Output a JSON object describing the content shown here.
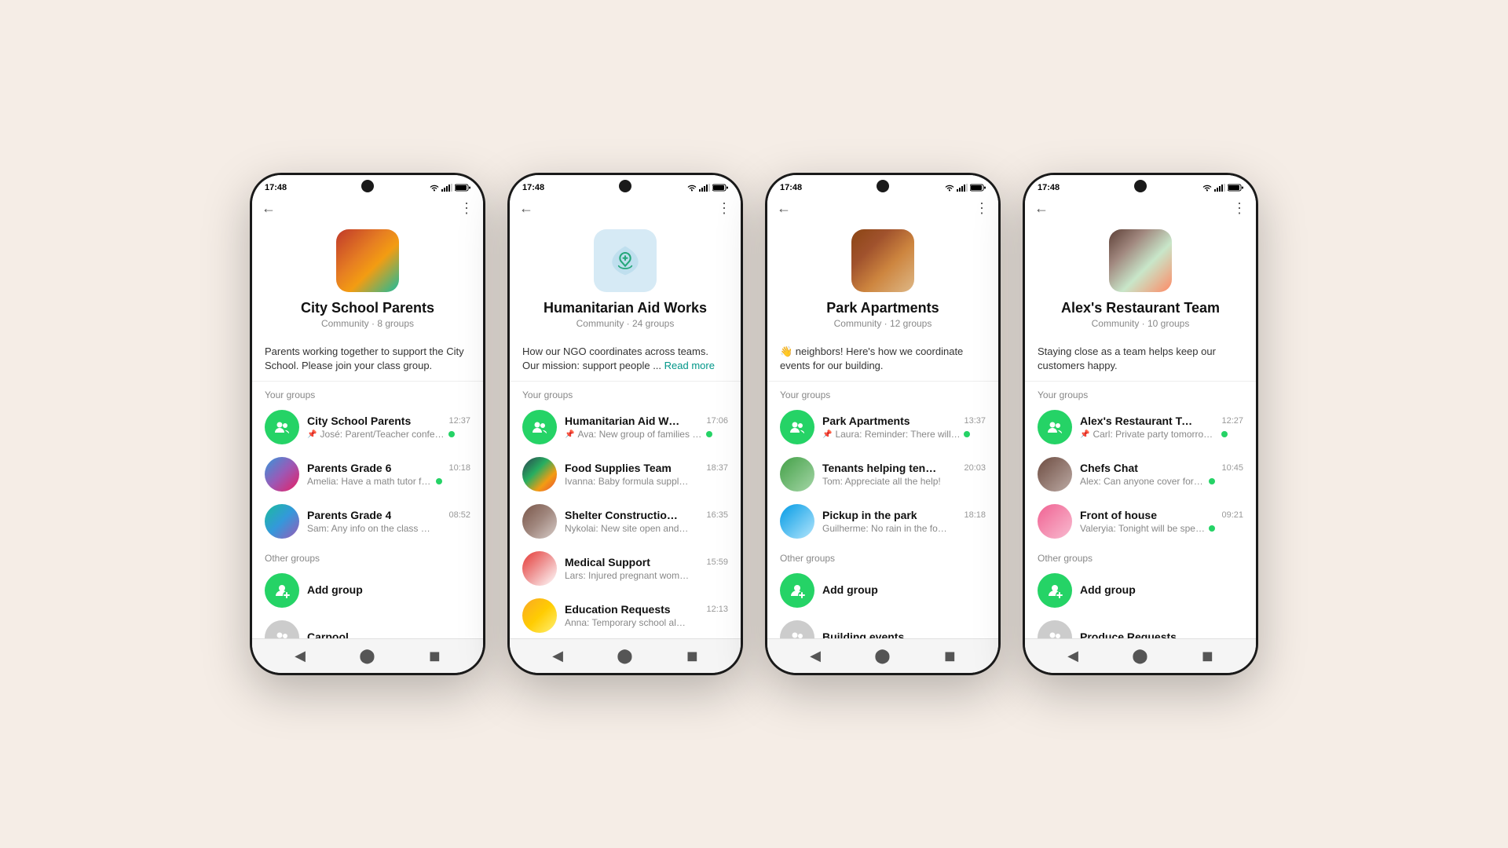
{
  "phones": [
    {
      "id": "city-school",
      "statusTime": "17:48",
      "communityName": "City School Parents",
      "communitySub": "Community · 8 groups",
      "avatarType": "photo",
      "avatarClass": "photo-books",
      "description": "Parents working together to support the City School. Please join your class group.",
      "readMore": false,
      "yourGroupsLabel": "Your groups",
      "yourGroups": [
        {
          "name": "City School Parents",
          "time": "12:37",
          "msg": "José: Parent/Teacher conferen...",
          "avatarType": "green-icon",
          "pinned": true,
          "online": true
        },
        {
          "name": "Parents Grade 6",
          "time": "10:18",
          "msg": "Amelia: Have a math tutor for the...",
          "avatarType": "photo",
          "avatarClass": "photo-grade6",
          "pinned": false,
          "online": true
        },
        {
          "name": "Parents Grade 4",
          "time": "08:52",
          "msg": "Sam: Any info on the class recital?",
          "avatarType": "photo",
          "avatarClass": "photo-grade4",
          "pinned": false,
          "online": false
        }
      ],
      "otherGroupsLabel": "Other groups",
      "otherGroups": [
        {
          "name": "Add group",
          "avatarType": "green-icon",
          "isAdd": true
        },
        {
          "name": "Carpool",
          "avatarType": "gray-icon",
          "isAdd": false
        }
      ]
    },
    {
      "id": "humanitarian",
      "statusTime": "17:48",
      "communityName": "Humanitarian Aid Works",
      "communitySub": "Community · 24 groups",
      "avatarType": "aid-svg",
      "description": "How our NGO coordinates across teams. Our mission: support people ...",
      "readMore": true,
      "yourGroupsLabel": "Your groups",
      "yourGroups": [
        {
          "name": "Humanitarian Aid Works",
          "time": "17:06",
          "msg": "Ava: New group of families waitin...",
          "avatarType": "green-icon",
          "pinned": true,
          "online": true
        },
        {
          "name": "Food Supplies Team",
          "time": "18:37",
          "msg": "Ivanna: Baby formula supplies running ...",
          "avatarType": "photo",
          "avatarClass": "photo-food",
          "pinned": false,
          "online": false
        },
        {
          "name": "Shelter Construction Team",
          "time": "16:35",
          "msg": "Nykolai: New site open and ready for ...",
          "avatarType": "photo",
          "avatarClass": "photo-shelter",
          "pinned": false,
          "online": false
        },
        {
          "name": "Medical Support",
          "time": "15:59",
          "msg": "Lars: Injured pregnant woman in need...",
          "avatarType": "photo",
          "avatarClass": "photo-medical",
          "pinned": false,
          "online": false
        },
        {
          "name": "Education Requests",
          "time": "12:13",
          "msg": "Anna: Temporary school almost comp...",
          "avatarType": "photo",
          "avatarClass": "photo-education",
          "pinned": false,
          "online": false
        }
      ],
      "otherGroupsLabel": "",
      "otherGroups": []
    },
    {
      "id": "park-apartments",
      "statusTime": "17:48",
      "communityName": "Park Apartments",
      "communitySub": "Community · 12 groups",
      "avatarType": "photo",
      "avatarClass": "photo-building",
      "description": "👋 neighbors! Here's how we coordinate events for our building.",
      "readMore": false,
      "yourGroupsLabel": "Your groups",
      "yourGroups": [
        {
          "name": "Park Apartments",
          "time": "13:37",
          "msg": "Laura: Reminder: There will be...",
          "avatarType": "green-icon",
          "pinned": true,
          "online": true
        },
        {
          "name": "Tenants helping tenants",
          "time": "20:03",
          "msg": "Tom: Appreciate all the help!",
          "avatarType": "photo",
          "avatarClass": "photo-tenants",
          "pinned": false,
          "online": false
        },
        {
          "name": "Pickup in the park",
          "time": "18:18",
          "msg": "Guilherme: No rain in the forecast!",
          "avatarType": "photo",
          "avatarClass": "photo-pickup",
          "pinned": false,
          "online": false
        }
      ],
      "otherGroupsLabel": "Other groups",
      "otherGroups": [
        {
          "name": "Add group",
          "avatarType": "green-icon",
          "isAdd": true
        },
        {
          "name": "Building events",
          "avatarType": "gray-icon",
          "isAdd": false
        }
      ]
    },
    {
      "id": "alex-restaurant",
      "statusTime": "17:48",
      "communityName": "Alex's Restaurant Team",
      "communitySub": "Community · 10 groups",
      "avatarType": "photo",
      "avatarClass": "photo-food-rest",
      "description": "Staying close as a team helps keep our customers happy.",
      "readMore": false,
      "yourGroupsLabel": "Your groups",
      "yourGroups": [
        {
          "name": "Alex's Restaurant Team",
          "time": "12:27",
          "msg": "Carl: Private party tomorrow in...",
          "avatarType": "green-icon",
          "pinned": true,
          "online": true
        },
        {
          "name": "Chefs Chat",
          "time": "10:45",
          "msg": "Alex: Can anyone cover for me?",
          "avatarType": "photo",
          "avatarClass": "photo-chefs",
          "pinned": false,
          "online": true
        },
        {
          "name": "Front of house",
          "time": "09:21",
          "msg": "Valeryia: Tonight will be special!",
          "avatarType": "photo",
          "avatarClass": "photo-front",
          "pinned": false,
          "online": true
        }
      ],
      "otherGroupsLabel": "Other groups",
      "otherGroups": [
        {
          "name": "Add group",
          "avatarType": "green-icon",
          "isAdd": true
        },
        {
          "name": "Produce Requests",
          "avatarType": "gray-icon",
          "isAdd": false
        }
      ]
    }
  ]
}
